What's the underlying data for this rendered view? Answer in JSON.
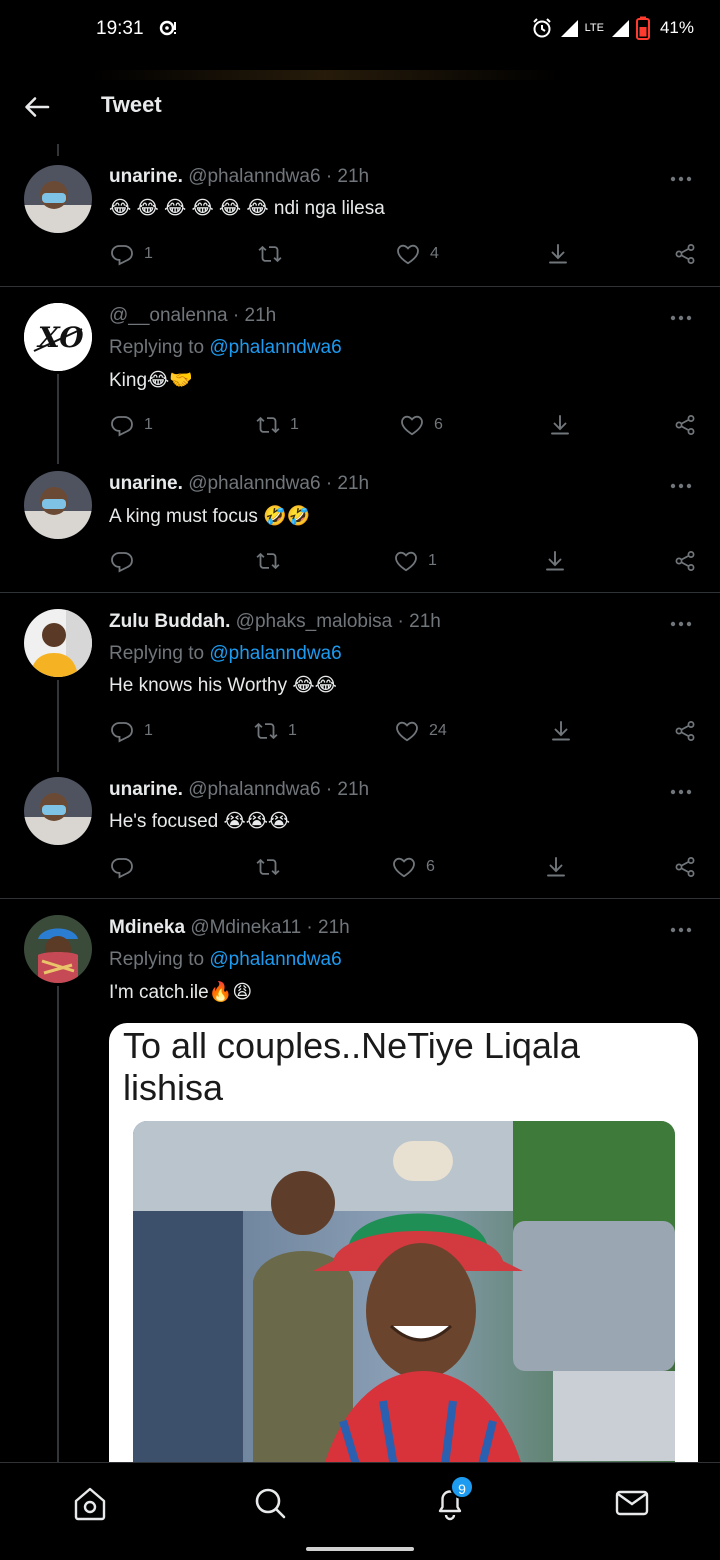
{
  "status_bar": {
    "time": "19:31",
    "network": "LTE",
    "battery": "41%"
  },
  "header": {
    "title": "Tweet"
  },
  "tweets": [
    {
      "name": "unarine.",
      "handle": "@phalanndwa6",
      "time": "21h",
      "replying_to": "",
      "text": "😂 😂 😂 😂 😂 😂 ndi nga lilesa",
      "replies": "1",
      "retweets": "",
      "likes": "4"
    },
    {
      "name": "",
      "handle": "@__onalenna",
      "time": "21h",
      "replying_label": "Replying to",
      "replying_to": "@phalanndwa6",
      "text": "King😂🤝",
      "replies": "1",
      "retweets": "1",
      "likes": "6"
    },
    {
      "name": "unarine.",
      "handle": "@phalanndwa6",
      "time": "21h",
      "replying_to": "",
      "text": "A king must focus 🤣🤣",
      "replies": "",
      "retweets": "",
      "likes": "1"
    },
    {
      "name": "Zulu Buddah.",
      "handle": "@phaks_malobisa",
      "time": "21h",
      "replying_label": "Replying to",
      "replying_to": "@phalanndwa6",
      "text": "He knows his Worthy 😂😂",
      "replies": "1",
      "retweets": "1",
      "likes": "24"
    },
    {
      "name": "unarine.",
      "handle": "@phalanndwa6",
      "time": "21h",
      "replying_to": "",
      "text": "He's focused 😭😭😭",
      "replies": "",
      "retweets": "",
      "likes": "6"
    },
    {
      "name": "Mdineka",
      "handle": "@Mdineka11",
      "time": "21h",
      "replying_label": "Replying to",
      "replying_to": "@phalanndwa6",
      "text": "I'm catch.ile🔥😩",
      "card_text": "To all couples..NeTiye Liqala lishisa"
    }
  ],
  "bottom_nav": {
    "notifications_badge": "9"
  },
  "icons": [
    "back-arrow-icon",
    "more-icon",
    "reply-icon",
    "retweet-icon",
    "like-icon",
    "download-icon",
    "share-icon",
    "home-icon",
    "search-icon",
    "bell-icon",
    "mail-icon"
  ],
  "colors": {
    "background": "#000000",
    "accent": "#1d9bf0",
    "muted": "#71767b",
    "text": "#e7e9ea"
  }
}
